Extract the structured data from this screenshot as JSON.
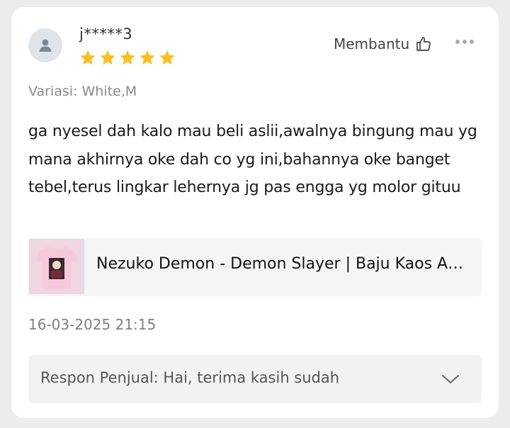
{
  "review": {
    "username": "j*****3",
    "rating": 5,
    "helpful_label": "Membantu",
    "variant": "Variasi: White,M",
    "text": "ga nyesel dah kalo mau beli aslii,awalnya bingung mau yg mana akhirnya oke dah co yg ini,bahannya oke banget tebel,terus lingkar lehernya jg pas engga yg molor gituu",
    "timestamp": "16-03-2025 21:15"
  },
  "product": {
    "title": "Nezuko Demon - Demon Slayer | Baju Kaos Anime"
  },
  "seller_response": {
    "text": "Respon Penjual: Hai, terima kasih sudah"
  },
  "colors": {
    "star": "#fbbf1f",
    "card_bg": "#ffffff",
    "page_bg": "#ececec"
  },
  "icons": {
    "avatar": "user-icon",
    "helpful": "thumbs-up-icon",
    "more": "more-options-icon",
    "expand": "chevron-down-icon"
  }
}
